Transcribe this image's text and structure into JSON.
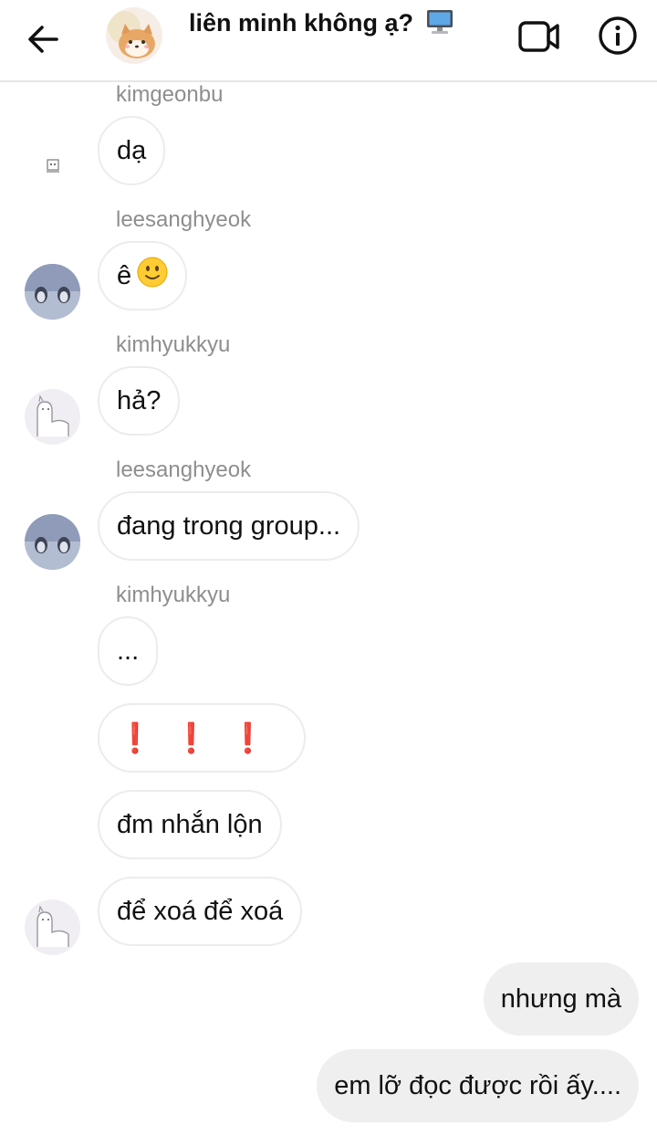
{
  "header": {
    "title": "liên minh không ạ?",
    "title_emoji_icon": "desktop-computer-icon",
    "back_icon": "arrow-left-icon",
    "video_icon": "video-camera-icon",
    "info_icon": "info-icon"
  },
  "messages": [
    {
      "sender": "kimgeonbu",
      "text": "dạ",
      "avatar": "small-character-icon"
    },
    {
      "sender": "leesanghyeok",
      "text": "ê",
      "emoji": "slightly-smiling-face-icon",
      "avatar": "penguins-avatar"
    },
    {
      "sender": "kimhyukkyu",
      "text": "hả?",
      "avatar": "alpaca-avatar"
    },
    {
      "sender": "leesanghyeok",
      "text": "đang trong group...",
      "avatar": "penguins-avatar"
    },
    {
      "sender": "kimhyukkyu",
      "texts": [
        "...",
        "❗❗❗",
        "đm nhắn lộn",
        "để xoá để xoá"
      ],
      "avatar": "alpaca-avatar"
    }
  ],
  "outgoing": [
    {
      "text": "nhưng mà"
    },
    {
      "text": "em lỡ đọc được rồi ấy...."
    }
  ],
  "colors": {
    "incoming_border": "#ececec",
    "outgoing_bg": "#efefef",
    "sender_text": "#8e8e8e",
    "exclamation": "#e0303c"
  }
}
